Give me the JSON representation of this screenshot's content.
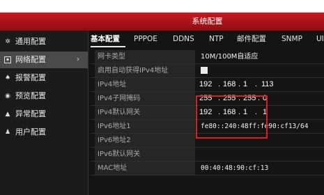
{
  "window": {
    "title": "系统配置"
  },
  "sidebar": {
    "items": [
      {
        "label": "通用配置",
        "icon": "gear-icon"
      },
      {
        "label": "网络配置",
        "icon": "network-icon",
        "active": true,
        "arrow": "›"
      },
      {
        "label": "报警配置",
        "icon": "alarm-icon"
      },
      {
        "label": "预览配置",
        "icon": "eye-icon"
      },
      {
        "label": "异常配置",
        "icon": "warning-icon"
      },
      {
        "label": "用户配置",
        "icon": "user-icon"
      }
    ]
  },
  "tabs": [
    "基本配置",
    "PPPOE",
    "DDNS",
    "NTP",
    "邮件配置",
    "SNMP",
    "UI"
  ],
  "fields": {
    "nic_type": {
      "label": "网卡类型",
      "value": "10M/100M自适应"
    },
    "dhcp": {
      "label": "启用自动获得IPv4地址",
      "checked": false
    },
    "ipv4_address": {
      "label": "IPv4地址",
      "octets": [
        "192",
        "168",
        "1",
        "113"
      ]
    },
    "ipv4_mask": {
      "label": "IPv4子网掩码",
      "octets": [
        "255",
        "255",
        "255",
        "0"
      ]
    },
    "ipv4_gateway": {
      "label": "IPv4默认网关",
      "octets": [
        "192",
        "168",
        "1",
        "1"
      ]
    },
    "ipv6_address1": {
      "label": "IPv6地址1",
      "value": "fe80::240:48ff:fe90:cf13/64"
    },
    "ipv6_address2": {
      "label": "IPv6地址2",
      "value": ""
    },
    "ipv6_gateway": {
      "label": "IPv6默认网关",
      "value": ""
    },
    "mac": {
      "label": "MAC地址",
      "value": "00:40:48:90:cf:13"
    }
  },
  "colors": {
    "titlebar": "#b5141b",
    "highlight": "#e21c27",
    "background": "#141414"
  }
}
